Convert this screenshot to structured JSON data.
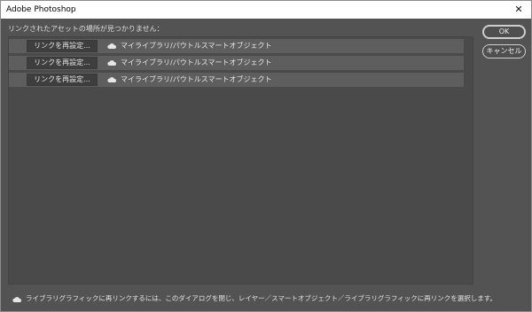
{
  "window": {
    "title": "Adobe Photoshop",
    "close_glyph": "✕"
  },
  "dialog": {
    "heading": "リンクされたアセットの場所が見つかりません：",
    "rows": [
      {
        "relink_label": "リンクを再設定...",
        "icon": "cloud-icon",
        "asset_name": "マイライブラリ/パウトルスマートオブジェクト"
      },
      {
        "relink_label": "リンクを再設定...",
        "icon": "cloud-icon",
        "asset_name": "マイライブラリ/パウトルスマートオブジェクト"
      },
      {
        "relink_label": "リンクを再設定...",
        "icon": "cloud-icon",
        "asset_name": "マイライブラリ/パウトルスマートオブジェクト"
      }
    ],
    "ok_label": "OK",
    "cancel_label": "キャンセル",
    "footer_icon": "cloud-icon",
    "footer_text": "ライブラリグラフィックに再リンクするには、このダイアログを閉じ、レイヤー／スマートオブジェクト／ライブラリグラフィックに再リンクを選択します。"
  },
  "colors": {
    "dialog_background": "#535353",
    "list_background": "#4a4a4a",
    "row_background": "#5e5e5e",
    "button_background": "#3e3e3e",
    "text": "#e6e6e6"
  }
}
